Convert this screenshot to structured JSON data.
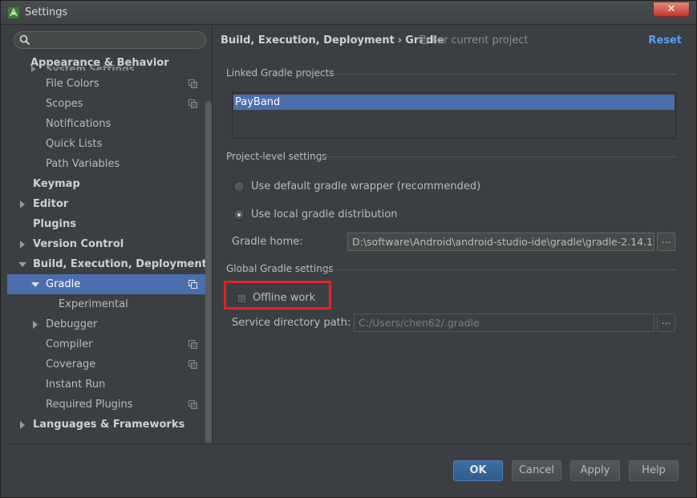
{
  "window": {
    "title": "Settings",
    "close_label": "✕"
  },
  "search": {
    "placeholder": "",
    "value": ""
  },
  "sidebar": {
    "header": "Appearance & Behavior",
    "cut_item": "System Settings",
    "items": [
      {
        "label": "File Colors",
        "copy": true
      },
      {
        "label": "Scopes",
        "copy": true
      },
      {
        "label": "Notifications",
        "copy": false
      },
      {
        "label": "Quick Lists",
        "copy": false
      },
      {
        "label": "Path Variables",
        "copy": false
      },
      {
        "label": "Keymap"
      },
      {
        "label": "Editor"
      },
      {
        "label": "Plugins"
      },
      {
        "label": "Version Control"
      },
      {
        "label": "Build, Execution, Deployment"
      },
      {
        "label": "Gradle"
      },
      {
        "label": "Experimental"
      },
      {
        "label": "Debugger"
      },
      {
        "label": "Compiler"
      },
      {
        "label": "Coverage"
      },
      {
        "label": "Instant Run"
      },
      {
        "label": "Required Plugins"
      },
      {
        "label": "Languages & Frameworks"
      }
    ]
  },
  "content": {
    "breadcrumb_parent": "Build, Execution, Deployment",
    "breadcrumb_sep": "›",
    "breadcrumb_current": "Gradle",
    "scope_label": "For current project",
    "reset_label": "Reset",
    "linked_title": "Linked Gradle projects",
    "linked_projects": [
      "PayBand"
    ],
    "project_level_title": "Project-level settings",
    "radio_default": "Use default gradle wrapper (recommended)",
    "radio_local": "Use local gradle distribution",
    "gradle_home_label": "Gradle home:",
    "gradle_home_value": "D:\\software\\Android\\android-studio-ide\\gradle\\gradle-2.14.1",
    "browse_label": "...",
    "global_title": "Global Gradle settings",
    "offline_label": "Offline work",
    "service_dir_label": "Service directory path:",
    "service_dir_value": "C:/Users/chen62/.gradle"
  },
  "footer": {
    "ok": "OK",
    "cancel": "Cancel",
    "apply": "Apply",
    "help": "Help"
  },
  "colors": {
    "selection": "#4b6eaf",
    "link": "#589df6",
    "highlight": "#e0242a",
    "background": "#3c3f41"
  }
}
